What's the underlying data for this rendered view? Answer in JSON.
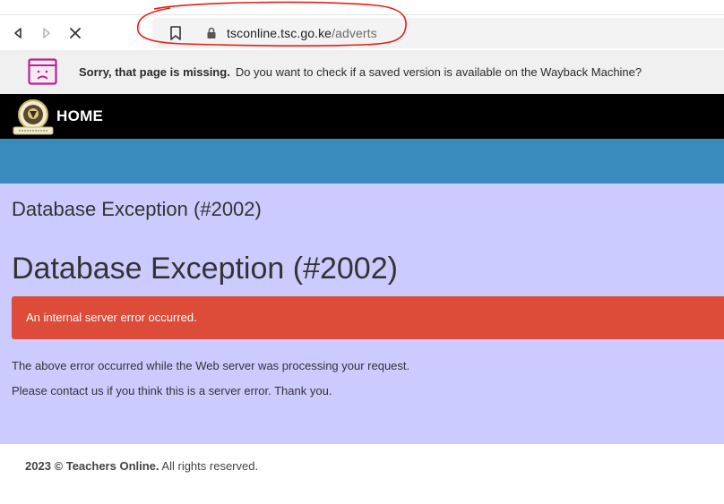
{
  "browser": {
    "url_domain": "tsconline.tsc.go.ke",
    "url_path": "/adverts",
    "annotation_color": "#e3201b"
  },
  "notice": {
    "title": "Sorry, that page is missing.",
    "message": "Do you want to check if a saved version is available on the Wayback Machine?",
    "icon": "sad-page-icon",
    "icon_color": "#b5248f"
  },
  "site": {
    "nav_home": "HOME",
    "nav_color": "#000000",
    "band_color": "#3a8bbd",
    "content_bg": "#cccbff"
  },
  "page": {
    "breadcrumb_title": "Database Exception (#2002)",
    "title": "Database Exception (#2002)",
    "alert": "An internal server error occurred.",
    "alert_color": "#dd4b39",
    "message_1": "The above error occurred while the Web server was processing your request.",
    "message_2": "Please contact us if you think this is a server error. Thank you."
  },
  "footer": {
    "prefix": "2023 © Teachers Online.",
    "suffix": " All rights reserved."
  }
}
